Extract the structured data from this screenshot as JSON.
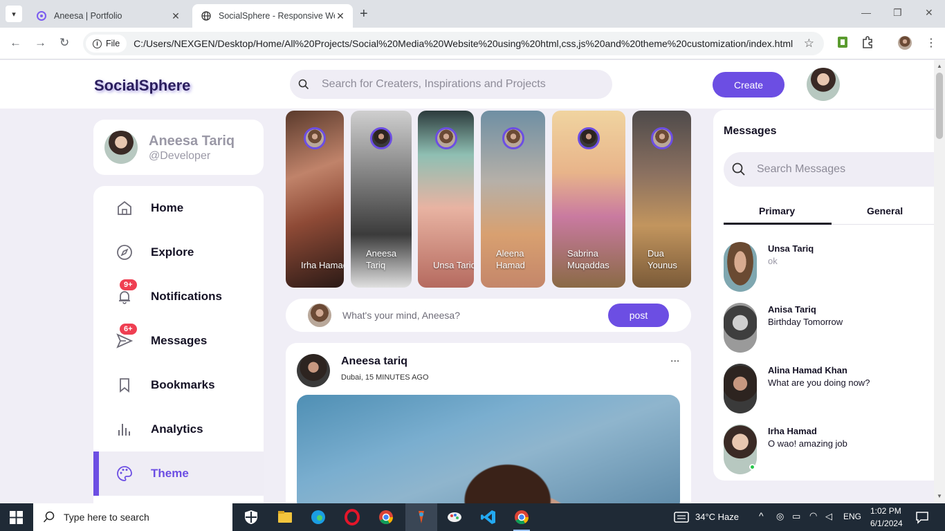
{
  "browser": {
    "tabs": [
      {
        "title": "Aneesa | Portfolio"
      },
      {
        "title": "SocialSphere - Responsive Web"
      }
    ],
    "url": "C:/Users/NEXGEN/Desktop/Home/All%20Projects/Social%20Media%20Website%20using%20html,css,js%20and%20theme%20customization/index.html",
    "protocol_label": "File"
  },
  "navbar": {
    "logo": "SocialSphere",
    "search_placeholder": "Search for Creaters, Inspirations and Projects",
    "create_label": "Create"
  },
  "profile": {
    "name": "Aneesa Tariq",
    "handle": "@Developer"
  },
  "sidebar": {
    "items": [
      {
        "label": "Home",
        "icon": "home-icon"
      },
      {
        "label": "Explore",
        "icon": "compass-icon"
      },
      {
        "label": "Notifications",
        "icon": "bell-icon",
        "badge": "9+"
      },
      {
        "label": "Messages",
        "icon": "send-icon",
        "badge": "6+"
      },
      {
        "label": "Bookmarks",
        "icon": "bookmark-icon"
      },
      {
        "label": "Analytics",
        "icon": "chart-icon"
      },
      {
        "label": "Theme",
        "icon": "palette-icon",
        "active": true
      }
    ]
  },
  "stories": [
    {
      "name": "Irha Hamad"
    },
    {
      "name": "Aneesa Tariq"
    },
    {
      "name": "Unsa Tariq"
    },
    {
      "name": "Aleena Hamad"
    },
    {
      "name": "Sabrina Muqaddas"
    },
    {
      "name": "Dua Younus"
    }
  ],
  "composer": {
    "placeholder": "What's your mind, Aneesa?",
    "post_label": "post"
  },
  "feed": {
    "author": "Aneesa tariq",
    "meta": "Dubai, 15 MINUTES AGO",
    "more": "..."
  },
  "messages": {
    "title": "Messages",
    "search_placeholder": "Search Messages",
    "tabs": [
      "Primary",
      "General"
    ],
    "items": [
      {
        "name": "Unsa Tariq",
        "text": "ok"
      },
      {
        "name": "Anisa Tariq",
        "text": "Birthday Tomorrow"
      },
      {
        "name": "Alina Hamad Khan",
        "text": "What are you doing now?"
      },
      {
        "name": "Irha Hamad",
        "text": "O wao! amazing job"
      }
    ]
  },
  "taskbar": {
    "search_placeholder": "Type here to search",
    "weather": "34°C  Haze",
    "language": "ENG",
    "time": "1:02 PM",
    "date": "6/1/2024"
  },
  "colors": {
    "accent": "#6c4ee3",
    "badge": "#ef3f52",
    "online": "#26c64a"
  }
}
